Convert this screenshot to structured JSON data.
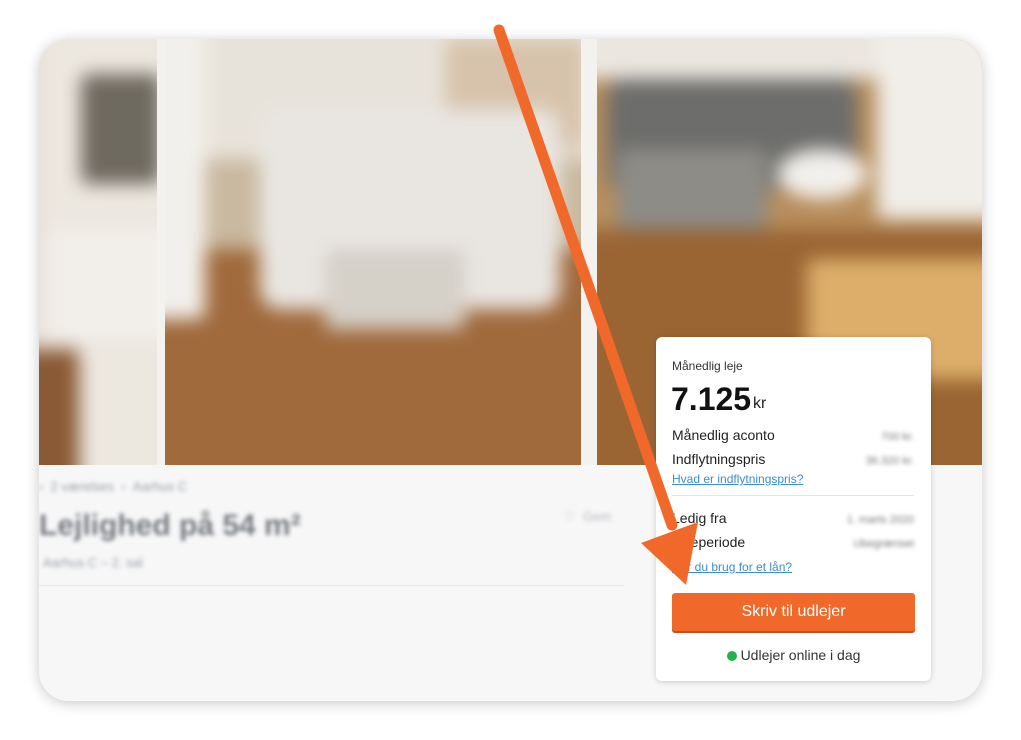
{
  "panel": {
    "monthly_rent_label": "Månedlig leje",
    "price": "7.125",
    "currency": "kr",
    "aconto_label": "Månedlig aconto",
    "moving_price_label": "Indflytningspris",
    "moving_price_link": "Hvad er indflytningspris?",
    "available_label": "Ledig fra",
    "rental_period_label": "Lejeperiode",
    "loan_link": "Har du brug for et lån?",
    "cta_label": "Skriv til udlejer",
    "online_status": "Udlejer online i dag",
    "online_color": "#22b24c"
  },
  "listing": {
    "headline": "Lejlighed på 54 m²"
  },
  "accent_color": "#f0692a",
  "arrow_color": "#f0692a"
}
